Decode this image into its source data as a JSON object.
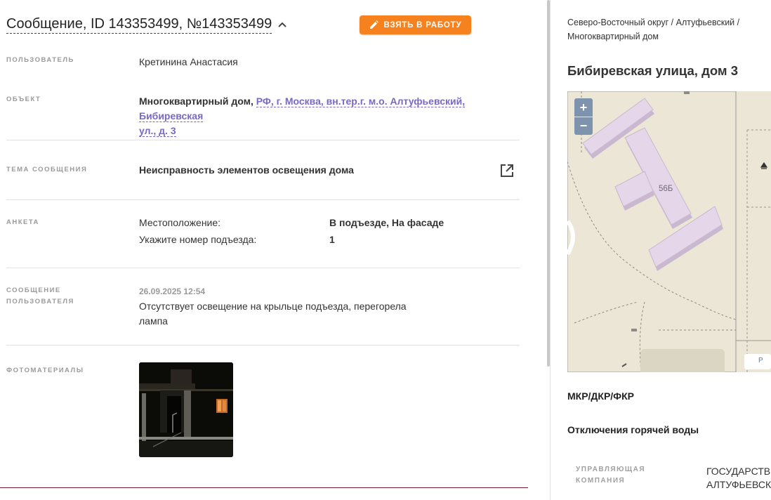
{
  "header": {
    "title": "Сообщение, ID 143353499, №143353499",
    "take_button": "ВЗЯТЬ В РАБОТУ"
  },
  "fields": {
    "user_label": "ПОЛЬЗОВАТЕЛЬ",
    "user_value": "Кретинина Анастасия",
    "object_label": "ОБЪЕКТ",
    "object_type": "Многоквартирный дом,",
    "object_addr_line1": "РФ, г. Москва, вн.тер.г. м.о. Алтуфьевский, Бибиревская",
    "object_addr_line2": "ул., д. 3",
    "topic_label": "ТЕМА СООБЩЕНИЯ",
    "topic_value": "Неисправность элементов освещения дома",
    "form_label": "АНКЕТА",
    "form_rows": [
      {
        "q": "Местоположение:",
        "a": "В подъезде, На фасаде"
      },
      {
        "q": "Укажите номер подъезда:",
        "a": "1"
      }
    ],
    "msg_label_1": "СООБЩЕНИЕ",
    "msg_label_2": "ПОЛЬЗОВАТЕЛЯ",
    "msg_date": "26.09.2025 12:54",
    "msg_line1": "Отсутствует освещение на крыльце подъезда, перегорела",
    "msg_line2": "лампа",
    "photos_label": "ФОТОМАТЕРИАЛЫ"
  },
  "side": {
    "breadcrumb_line1": "Северо-Восточный округ / Алтуфьевский /",
    "breadcrumb_line2": "Многоквартирный дом",
    "address": "Бибиревская улица, дом 3",
    "map": {
      "zoom_in": "+",
      "zoom_out": "−",
      "building_label": "56Б",
      "parking_label": "P"
    },
    "section1": "МКР/ДКР/ФКР",
    "section2": "Отключения горячей воды",
    "mgmt_label_1": "УПРАВЛЯЮЩАЯ",
    "mgmt_label_2": "КОМПАНИЯ",
    "mgmt_value_1": "ГОСУДАРСТВЕННОЕ",
    "mgmt_value_2": "АЛТУФЬЕВСКОЕ"
  },
  "colors": {
    "accent": "#f5821f",
    "link": "#7b68c4",
    "map_bg": "#ebe6d6",
    "building": "#e6d6ea",
    "zoom_control": "#7e93ad"
  },
  "icons": [
    "chevron-up-icon",
    "pencil-icon",
    "external-link-icon"
  ]
}
